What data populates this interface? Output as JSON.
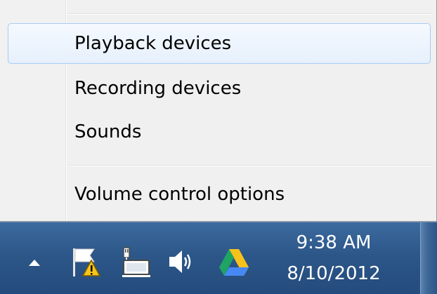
{
  "menu": {
    "items": [
      {
        "label": "Playback devices",
        "highlighted": true
      },
      {
        "label": "Recording devices",
        "highlighted": false
      },
      {
        "label": "Sounds",
        "highlighted": false
      },
      {
        "label": "Volume control options",
        "highlighted": false
      }
    ]
  },
  "taskbar": {
    "tray_icons": [
      "overflow-chevron-icon",
      "action-center-flag-icon",
      "network-icon",
      "speaker-icon",
      "google-drive-icon"
    ],
    "clock": {
      "time": "9:38 AM",
      "date": "8/10/2012"
    }
  },
  "colors": {
    "menu_background": "#f0f0f0",
    "highlight_border": "#a8cbf1",
    "taskbar": "#2d5789",
    "clock_text": "#ffffff"
  }
}
